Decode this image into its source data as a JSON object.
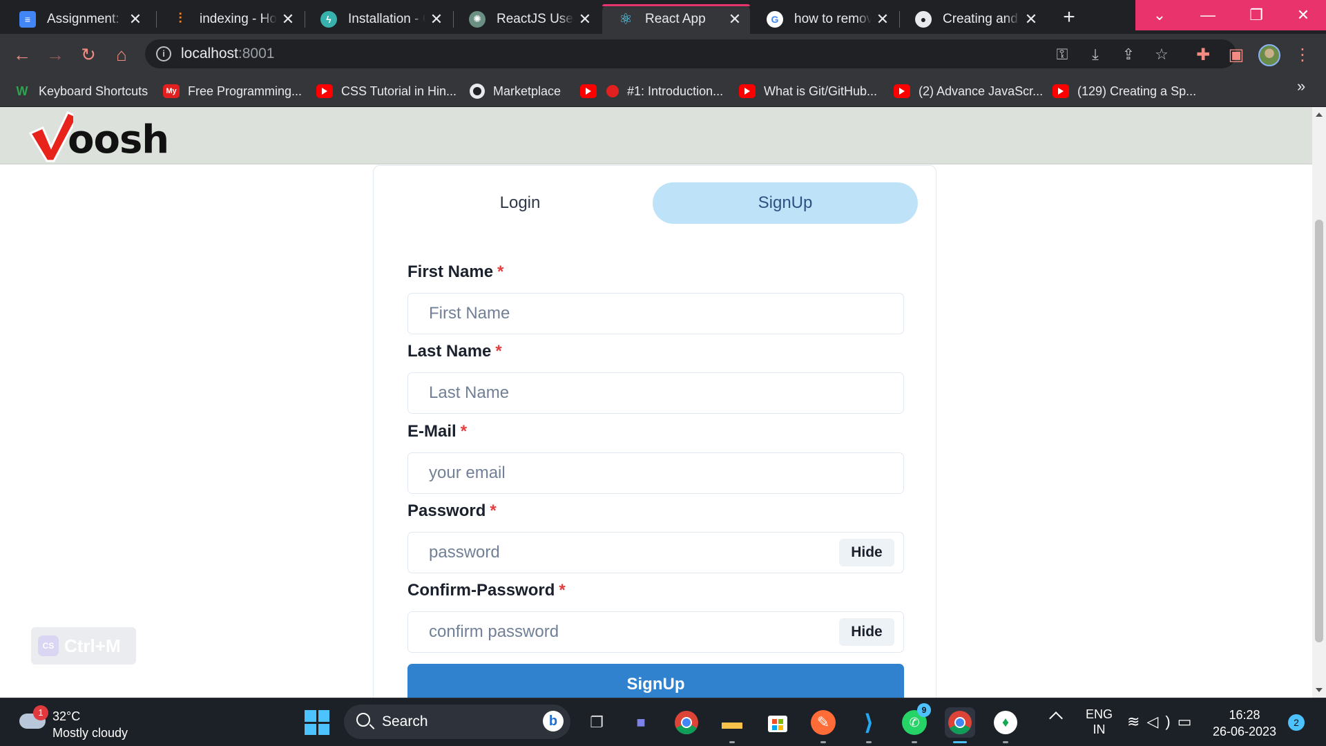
{
  "browser": {
    "tabs": [
      {
        "title": "Assignment: Full Stack",
        "icon": "docs-icon",
        "active": false
      },
      {
        "title": "indexing - How to",
        "icon": "stackoverflow-icon",
        "active": false
      },
      {
        "title": "Installation - Chakra",
        "icon": "chakra-icon",
        "active": false
      },
      {
        "title": "ReactJS User UI",
        "icon": "chatgpt-icon",
        "active": false
      },
      {
        "title": "React App",
        "icon": "react-icon",
        "active": true
      },
      {
        "title": "how to remove",
        "icon": "google-icon",
        "active": false
      },
      {
        "title": "Creating and hosting",
        "icon": "github-icon",
        "active": false
      }
    ],
    "url": {
      "host": "localhost",
      "port": ":8001"
    },
    "bookmarks": [
      {
        "label": "Keyboard Shortcuts",
        "icon": "w-icon"
      },
      {
        "label": "Free Programming...",
        "icon": "my-icon"
      },
      {
        "label": "CSS Tutorial in Hin...",
        "icon": "youtube-icon"
      },
      {
        "label": "Marketplace",
        "icon": "github-icon"
      },
      {
        "label": "#1: Introduction...",
        "icon": "record-icon"
      },
      {
        "label": "What is Git/GitHub...",
        "icon": "youtube-icon"
      },
      {
        "label": "(2) Advance JavaScr...",
        "icon": "youtube-icon"
      },
      {
        "label": "(129) Creating a Sp...",
        "icon": "youtube-icon"
      }
    ],
    "bookmarks_more": "»",
    "accent_color": "#e8336d"
  },
  "page": {
    "logo_text": "oosh",
    "tabs": {
      "login": "Login",
      "signup": "SignUp",
      "selected": "signup"
    },
    "fields": {
      "first_name": {
        "label": "First Name",
        "placeholder": "First Name"
      },
      "last_name": {
        "label": "Last Name",
        "placeholder": "Last Name"
      },
      "email": {
        "label": "E-Mail",
        "placeholder": "your email"
      },
      "password": {
        "label": "Password",
        "placeholder": "password",
        "toggle": "Hide"
      },
      "confirm_password": {
        "label": "Confirm-Password",
        "placeholder": "confirm password",
        "toggle": "Hide"
      }
    },
    "required_marker": "*",
    "submit_label": "SignUp",
    "extension_badge": {
      "icon": "CS",
      "text": "Ctrl+M"
    }
  },
  "taskbar": {
    "weather": {
      "temp": "32°C",
      "condition": "Mostly cloudy",
      "badge": "1"
    },
    "search_label": "Search",
    "whatsapp_count": "9",
    "language": {
      "line1": "ENG",
      "line2": "IN"
    },
    "time": "16:28",
    "date": "26-06-2023",
    "notifications": "2"
  }
}
